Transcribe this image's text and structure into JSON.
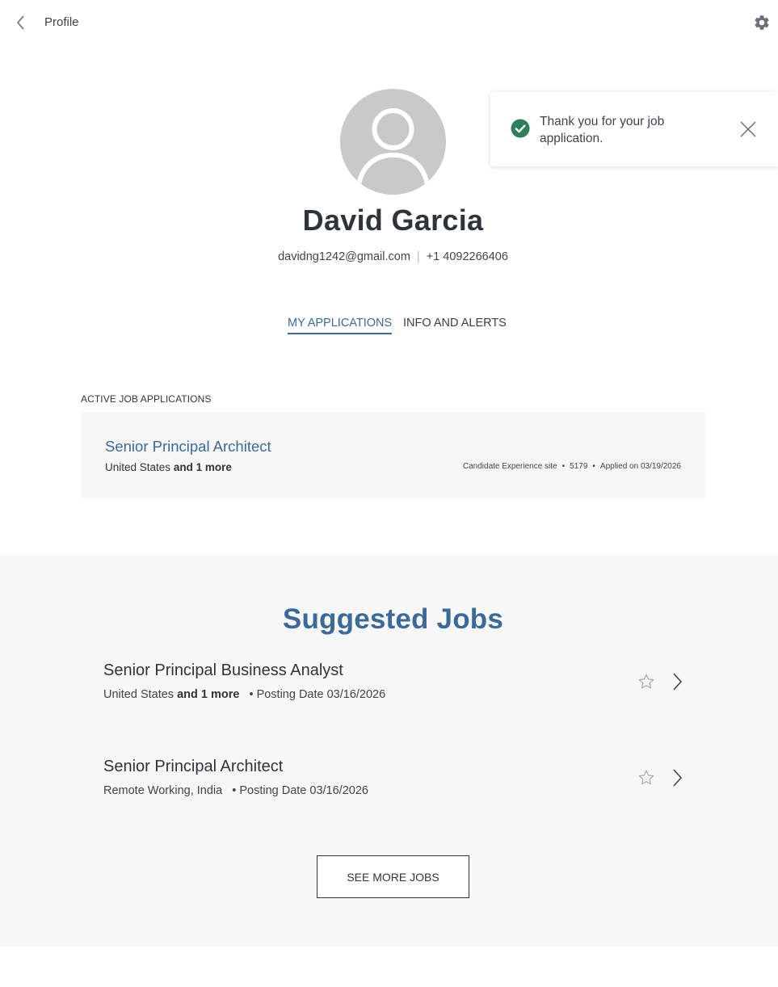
{
  "header": {
    "title": "Profile",
    "back_icon": "chevron-left-icon",
    "settings_icon": "gear-icon"
  },
  "toast": {
    "message": "Thank you for your job application.",
    "icon": "check-circle-icon",
    "close_icon": "close-icon",
    "color": "#2e7d5b"
  },
  "profile": {
    "name": "David Garcia",
    "email": "davidng1242@gmail.com",
    "separator": "|",
    "phone": "+1 4092266406",
    "avatar_icon": "user-avatar-icon"
  },
  "tabs": [
    {
      "label": "MY APPLICATIONS",
      "active": true
    },
    {
      "label": "INFO AND ALERTS",
      "active": false
    }
  ],
  "active_applications": {
    "section_label": "ACTIVE JOB APPLICATIONS",
    "items": [
      {
        "title": "Senior Principal Architect",
        "location": "United States",
        "location_more": "and 1 more",
        "site": "Candidate Experience site",
        "job_id": "5179",
        "applied": "Applied on 03/19/2026"
      }
    ]
  },
  "suggested_jobs": {
    "title": "Suggested Jobs",
    "jobs": [
      {
        "title": "Senior Principal Business Analyst",
        "location": "United States",
        "location_more": "and 1 more",
        "posting": "Posting Date 03/16/2026"
      },
      {
        "title": "Senior Principal Architect",
        "location": "Remote Working, India",
        "location_more": "",
        "posting": "Posting Date 03/16/2026"
      }
    ],
    "see_more_label": "SEE MORE JOBS"
  },
  "colors": {
    "accent": "#3b6a99",
    "text": "#2f343b",
    "panel": "#f7f7f7",
    "avatar": "#c9c9c9",
    "success": "#2e7d5b"
  }
}
